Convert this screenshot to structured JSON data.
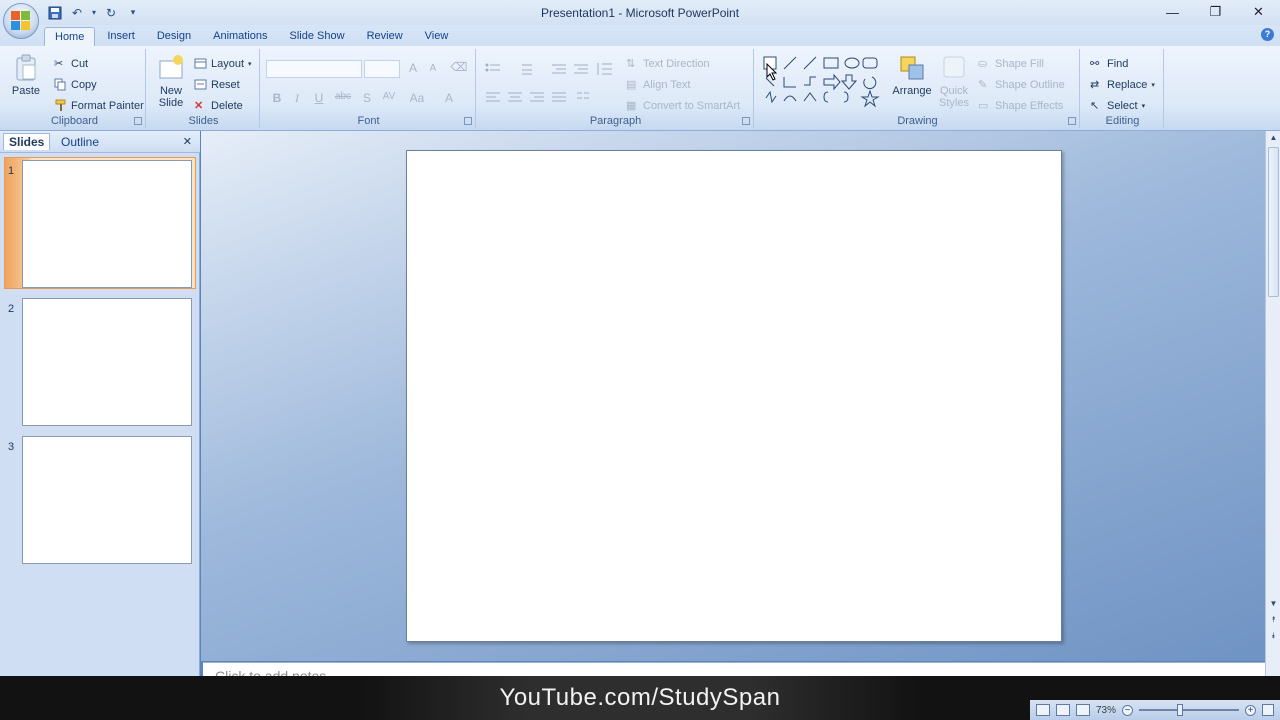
{
  "window": {
    "title": "Presentation1 - Microsoft PowerPoint",
    "controls": [
      "minimize-icon",
      "restore-icon",
      "close-icon"
    ]
  },
  "quick_access": [
    "save-icon",
    "undo-icon",
    "undo-dropdown-icon",
    "redo-icon",
    "customize-qat-icon"
  ],
  "tabs": [
    {
      "label": "Home",
      "active": true
    },
    {
      "label": "Insert"
    },
    {
      "label": "Design"
    },
    {
      "label": "Animations"
    },
    {
      "label": "Slide Show"
    },
    {
      "label": "Review"
    },
    {
      "label": "View"
    }
  ],
  "ribbon": {
    "clipboard": {
      "label": "Clipboard",
      "paste": "Paste",
      "cut": "Cut",
      "copy": "Copy",
      "format_painter": "Format Painter"
    },
    "slides": {
      "label": "Slides",
      "new_slide_line1": "New",
      "new_slide_line2": "Slide",
      "layout": "Layout",
      "reset": "Reset",
      "delete": "Delete"
    },
    "font": {
      "label": "Font"
    },
    "paragraph": {
      "label": "Paragraph",
      "text_direction": "Text Direction",
      "align_text": "Align Text",
      "convert_smartart": "Convert to SmartArt"
    },
    "drawing": {
      "label": "Drawing",
      "arrange": "Arrange",
      "quick_styles_line1": "Quick",
      "quick_styles_line2": "Styles",
      "shape_fill": "Shape Fill",
      "shape_outline": "Shape Outline",
      "shape_effects": "Shape Effects"
    },
    "editing": {
      "label": "Editing",
      "find": "Find",
      "replace": "Replace",
      "select": "Select"
    }
  },
  "left_panel": {
    "tab_slides": "Slides",
    "tab_outline": "Outline",
    "slides": [
      {
        "num": "1",
        "selected": true
      },
      {
        "num": "2"
      },
      {
        "num": "3"
      }
    ]
  },
  "notes": {
    "placeholder": "Click to add notes"
  },
  "watermark": "YouTube.com/StudySpan",
  "status": {
    "zoom": "73%"
  },
  "colors": {
    "accent": "#15428b",
    "selection": "#f0a35a"
  }
}
